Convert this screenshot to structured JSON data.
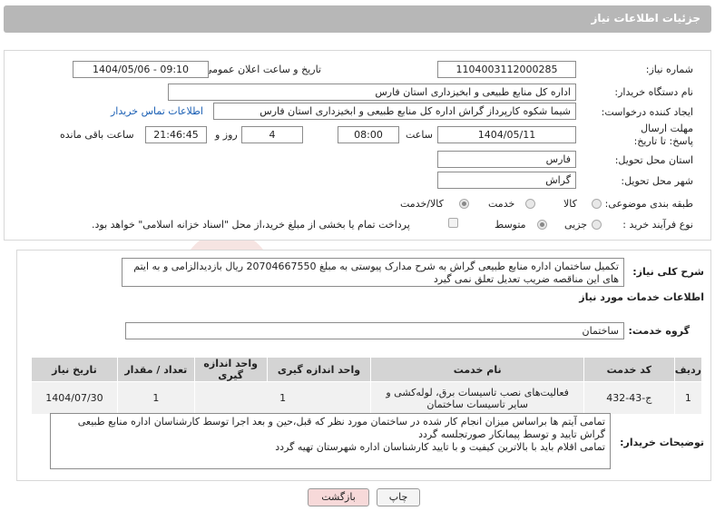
{
  "header": {
    "title": "جزئیات اطلاعات نیاز"
  },
  "form": {
    "need_number_label": "شماره نیاز:",
    "need_number": "1104003112000285",
    "announce_label": "تاریخ و ساعت اعلان عمومی:",
    "announce_value": "1404/05/06 - 09:10",
    "buyer_org_label": "نام دستگاه خریدار:",
    "buyer_org": "اداره کل منابع طبیعی و ابخیزداری استان فارس",
    "creator_label": "ایجاد کننده درخواست:",
    "creator": "شیما شکوه کارپرداز گراش اداره کل منابع طبیعی و ابخیزداری استان فارس",
    "contact_link": "اطلاعات تماس خریدار",
    "deadline_label": "مهلت ارسال پاسخ: تا تاریخ:",
    "deadline_date": "1404/05/11",
    "time_label": "ساعت",
    "deadline_time": "08:00",
    "days_value": "4",
    "days_label": "روز و",
    "remaining_time": "21:46:45",
    "remaining_label": "ساعت باقی مانده",
    "province_label": "استان محل تحویل:",
    "province": "فارس",
    "city_label": "شهر محل تحویل:",
    "city": "گراش",
    "category_label": "طبقه بندی موضوعی:",
    "category_options": [
      "کالا",
      "خدمت",
      "کالا/خدمت"
    ],
    "process_label": "نوع فرآیند خرید :",
    "process_options": [
      "جزیی",
      "متوسط"
    ],
    "payment_note": "پرداخت تمام یا بخشی از مبلغ خرید،از محل \"اسناد خزانه اسلامی\" خواهد بود."
  },
  "description": {
    "label": "شرح کلی نیاز:",
    "text": "تکمیل ساختمان اداره منابع طبیعی گراش به شرح مدارک پیوستی به مبلغ 20704667550 ریال بازدیدالزامی و به ایتم های این مناقصه ضریب تعدیل تعلق نمی گیرد"
  },
  "services": {
    "section_title": "اطلاعات خدمات مورد نیاز",
    "group_label": "گروه خدمت:",
    "group_value": "ساختمان",
    "columns": [
      "ردیف",
      "کد خدمت",
      "نام خدمت",
      "واحد اندازه گیری",
      "تعداد / مقدار",
      "تاریخ نیاز"
    ],
    "rows": [
      [
        "1",
        "ج-43-432",
        "فعالیت‌های نصب تاسیسات برق، لوله‌کشی و سایر تاسیسات ساختمان",
        "1",
        "1",
        "1404/07/30"
      ]
    ]
  },
  "notes": {
    "label": "توضیحات خریدار:",
    "text": "تمامی آیتم ها براساس میزان انجام کار شده در ساختمان مورد نظر که قبل،حین و بعد اجرا توسط کارشناسان اداره منابع طبیعی گراش تایید و توسط پیمانکار صورتجلسه گردد\nتمامی اقلام باید با بالاترین کیفیت و با تایید کارشناسان اداره شهرستان تهیه گردد"
  },
  "buttons": {
    "print": "چاپ",
    "back": "بازگشت"
  },
  "colors": {
    "header_bg": "#b7b7b7",
    "link": "#1a5fb4",
    "back_btn_bg": "#f7d9d9"
  },
  "watermark": "AriaTender.net"
}
